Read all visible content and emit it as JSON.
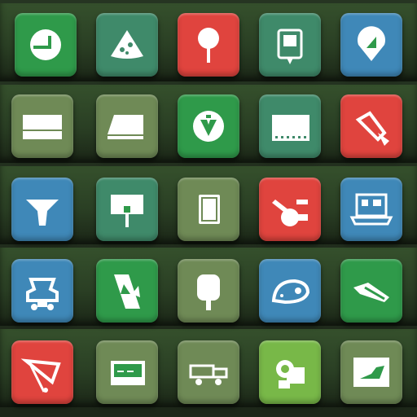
{
  "colors": {
    "red": "#e0443e",
    "green": "#2f9a4a",
    "teal": "#3f8a6a",
    "blue": "#3f88b8",
    "olive": "#6f8a56",
    "lime": "#78b848"
  },
  "tiles": [
    {
      "icon": "power-plug-icon",
      "color": "#2f9a4a"
    },
    {
      "icon": "cheese-wedge-icon",
      "color": "#3f8a6a"
    },
    {
      "icon": "lollipop-sign-icon",
      "color": "#e0443e"
    },
    {
      "icon": "bookmark-tag-icon",
      "color": "#3f8a6a"
    },
    {
      "icon": "map-pin-icon",
      "color": "#3f88b8"
    },
    {
      "icon": "panel-icon",
      "color": "#6f8a56"
    },
    {
      "icon": "document-tray-icon",
      "color": "#6f8a56"
    },
    {
      "icon": "circle-arrow-icon",
      "color": "#2f9a4a"
    },
    {
      "icon": "ticket-icon",
      "color": "#3f8a6a"
    },
    {
      "icon": "scraper-tool-icon",
      "color": "#e0443e"
    },
    {
      "icon": "funnel-icon",
      "color": "#3f88b8"
    },
    {
      "icon": "signpost-icon",
      "color": "#3f8a6a"
    },
    {
      "icon": "card-icon",
      "color": "#6f8a56"
    },
    {
      "icon": "robot-arm-icon",
      "color": "#e0443e"
    },
    {
      "icon": "laptop-icon",
      "color": "#3f88b8"
    },
    {
      "icon": "robot-head-icon",
      "color": "#3f88b8"
    },
    {
      "icon": "playing-card-icon",
      "color": "#2f9a4a"
    },
    {
      "icon": "ping-pong-paddle-icon",
      "color": "#6f8a56"
    },
    {
      "icon": "mouse-animal-icon",
      "color": "#3f88b8"
    },
    {
      "icon": "shoe-icon",
      "color": "#2f9a4a"
    },
    {
      "icon": "pennant-flag-icon",
      "color": "#e0443e"
    },
    {
      "icon": "credit-card-icon",
      "color": "#6f8a56"
    },
    {
      "icon": "truck-icon",
      "color": "#6f8a56"
    },
    {
      "icon": "puzzle-piece-icon",
      "color": "#78b848"
    },
    {
      "icon": "green-banner-icon",
      "color": "#6f8a56"
    }
  ]
}
